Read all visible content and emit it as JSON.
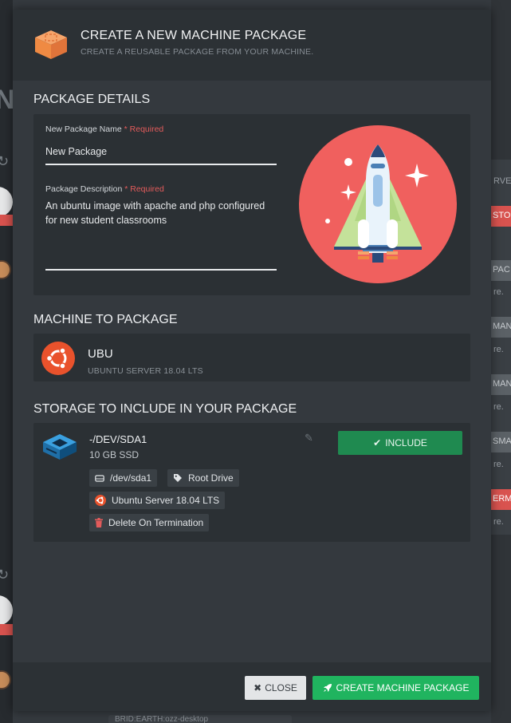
{
  "background": {
    "right_tags": [
      "RVER",
      "STO",
      "PAC",
      "re.",
      "MAN",
      "re.",
      "MAN",
      "re.",
      "SMA",
      "re.",
      "ERM",
      "re."
    ],
    "bottom_chip": "BRID:EARTH:ozz-desktop"
  },
  "modal": {
    "title": "CREATE A NEW MACHINE PACKAGE",
    "subtitle": "CREATE A REUSABLE PACKAGE FROM YOUR MACHINE."
  },
  "package_details": {
    "section_title": "PACKAGE DETAILS",
    "name_label": "New Package Name",
    "required_text": "* Required",
    "name_value": "New Package",
    "description_label": "Package Description",
    "description_value": "An ubuntu image with apache and php configured for new student classrooms"
  },
  "machine": {
    "section_title": "MACHINE TO PACKAGE",
    "name": "UBU",
    "os": "UBUNTU SERVER 18.04 LTS"
  },
  "storage": {
    "section_title": "STORAGE TO INCLUDE IN YOUR PACKAGE",
    "name": "-/DEV/SDA1",
    "size": "10 GB SSD",
    "include_label": "INCLUDE",
    "chips": {
      "device": "/dev/sda1",
      "tag": "Root Drive",
      "os": "Ubuntu Server 18.04 LTS",
      "delete": "Delete On Termination"
    }
  },
  "footer": {
    "close_label": "CLOSE",
    "create_label": "CREATE MACHINE PACKAGE"
  },
  "colors": {
    "include_green": "#1f8a50",
    "create_green": "#20b45f",
    "required_red": "#e25b5b",
    "ubuntu_orange": "#e9522c"
  }
}
